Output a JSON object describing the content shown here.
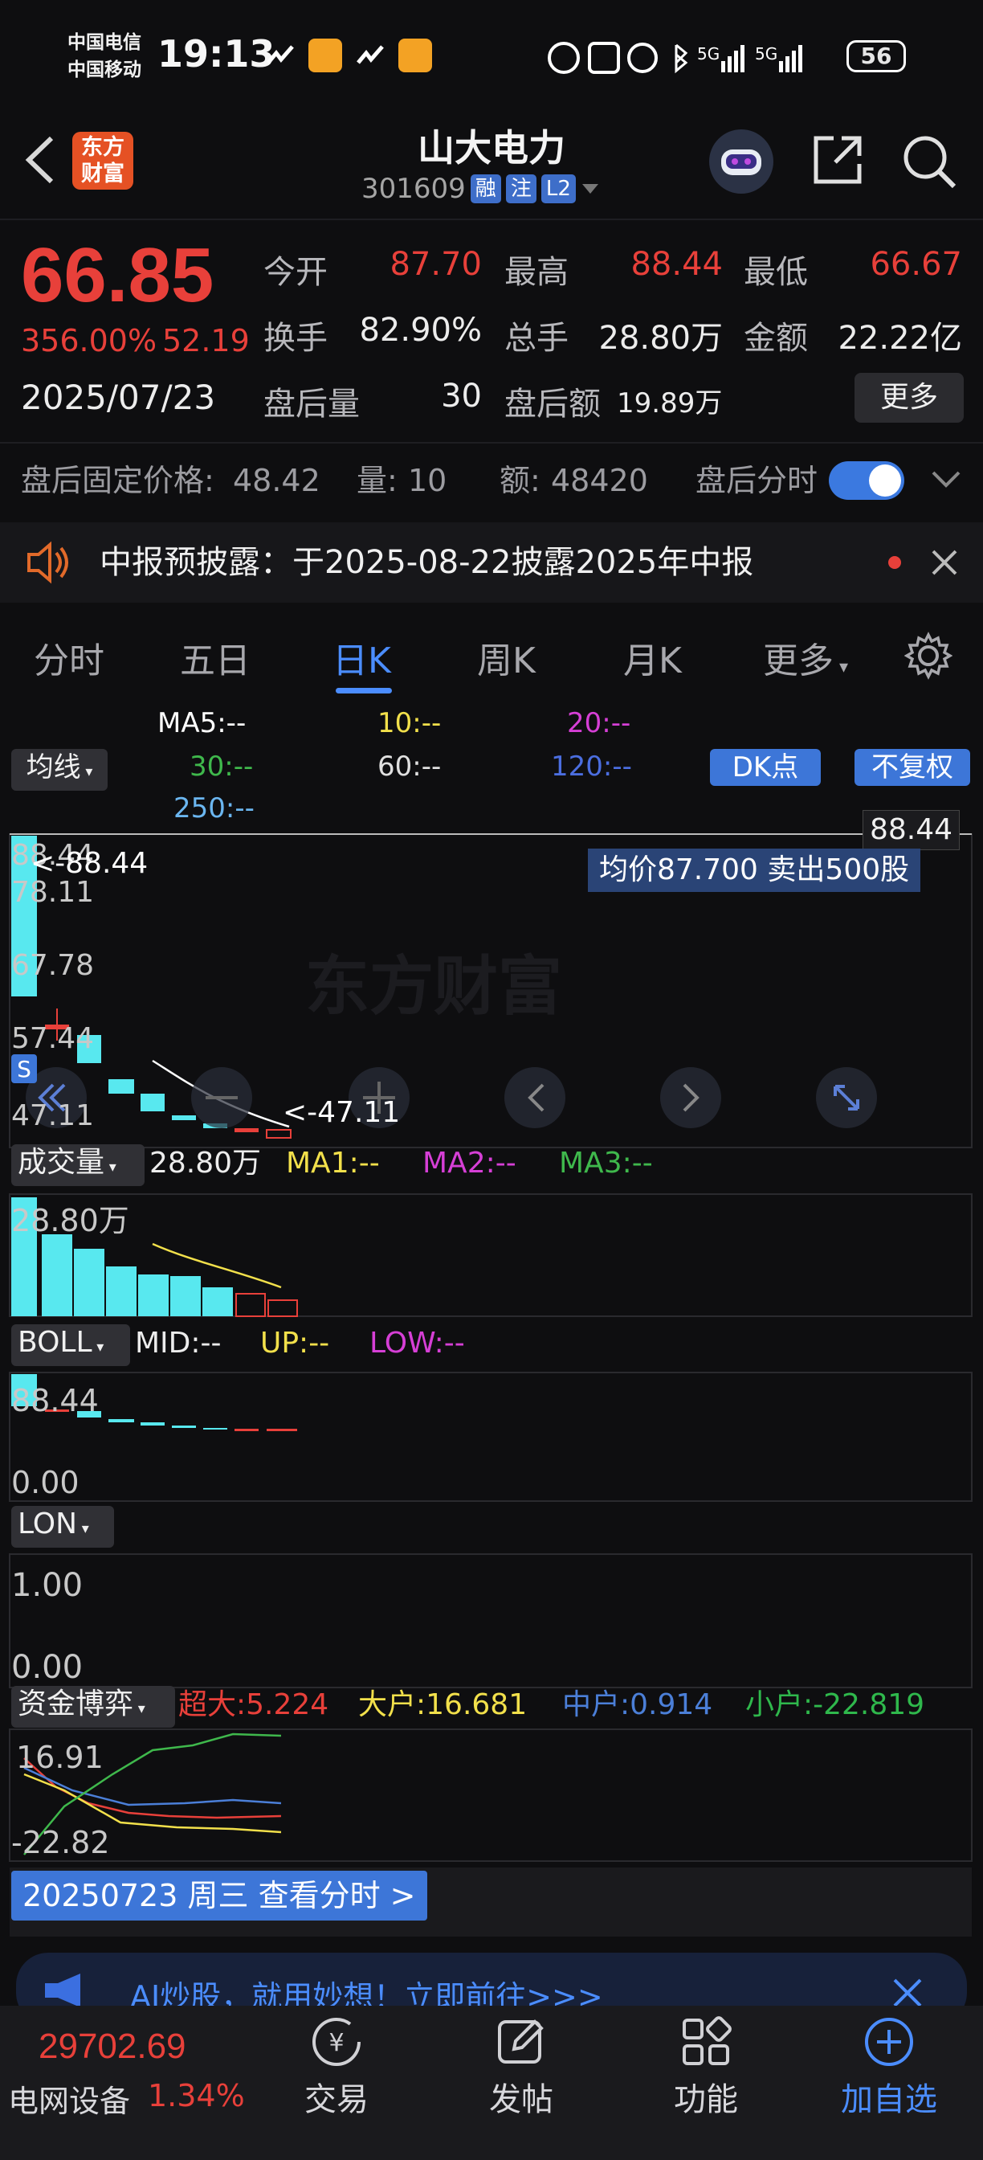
{
  "status_bar": {
    "carrier1": "中国电信",
    "carrier2": "中国移动",
    "time": "19:13",
    "battery": "56",
    "net1": "5G",
    "net2": "5G"
  },
  "header": {
    "logo_text": "东方财富",
    "stock_name": "山大电力",
    "stock_code": "301609",
    "badges": [
      "融",
      "注",
      "L2"
    ]
  },
  "quote": {
    "price": "66.85",
    "pct_change": "356.00%",
    "change": "52.19",
    "date": "2025/07/23",
    "open_label": "今开",
    "open": "87.70",
    "high_label": "最高",
    "high": "88.44",
    "low_label": "最低",
    "low": "66.67",
    "turnover_label": "换手",
    "turnover": "82.90%",
    "volume_label": "总手",
    "volume": "28.80万",
    "amount_label": "金额",
    "amount": "22.22亿",
    "ah_vol_label": "盘后量",
    "ah_vol": "30",
    "ah_amt_label": "盘后额",
    "ah_amt": "19.89万",
    "more": "更多"
  },
  "after_hours": {
    "fixed_price_label": "盘后固定价格:",
    "fixed_price": "48.42",
    "qty_label": "量:",
    "qty": "10",
    "amt_label": "额:",
    "amt": "48420",
    "intraday_label": "盘后分时",
    "toggle_on": true
  },
  "notice": {
    "text": "中报预披露：于2025-08-22披露2025年中报"
  },
  "tabs": [
    "分时",
    "五日",
    "日K",
    "周K",
    "月K",
    "更多"
  ],
  "active_tab": "日K",
  "ma_labels": {
    "ma5": "MA5:--",
    "ma10": "10:--",
    "ma20": "20:--",
    "ma30": "30:--",
    "ma60": "60:--",
    "ma120": "120:--",
    "ma250": "250:--",
    "indicator": "均线",
    "dk": "DK点",
    "fq": "不复权"
  },
  "kline": {
    "top_price": "88.44",
    "high_marker": "<-88.44",
    "low_marker": "<-47.11",
    "axis": [
      "88.44",
      "78.11",
      "67.78",
      "57.44",
      "47.11"
    ],
    "tooltip": "均价87.700  卖出500股",
    "watermark": "东方财富",
    "s_badge": "S"
  },
  "volume_panel": {
    "label": "成交量",
    "value": "28.80万",
    "ma1": "MA1:--",
    "ma2": "MA2:--",
    "ma3": "MA3:--",
    "axis_top": "28.80万"
  },
  "boll_panel": {
    "label": "BOLL",
    "mid": "MID:--",
    "up": "UP:--",
    "low": "LOW:--",
    "axis_top": "88.44",
    "axis_bottom": "0.00"
  },
  "lon_panel": {
    "label": "LON",
    "axis_top": "1.00",
    "axis_bottom": "0.00"
  },
  "fund_panel": {
    "label": "资金博弈",
    "super": "超大:5.224",
    "big": "大户:16.681",
    "mid": "中户:0.914",
    "small": "小户:-22.819",
    "axis_top": "16.91",
    "axis_bottom": "-22.82"
  },
  "date_link": "20250723 周三 查看分时 >",
  "ad": {
    "text": "AI炒股，就用妙想！立即前往>>>"
  },
  "bottom": {
    "index_value": "29702.69",
    "index_name": "电网设备",
    "index_pct": "1.34%",
    "nav": [
      "交易",
      "发帖",
      "功能",
      "加自选"
    ]
  },
  "colors": {
    "up": "#e8403a",
    "down": "#58e8ef",
    "accent": "#4b8dff",
    "ma5": "#ffffff",
    "ma10": "#f2e04b",
    "ma20": "#d63fd6",
    "ma30": "#3fb84c",
    "ma120": "#4b6ee0",
    "ma250": "#6bb6f0"
  }
}
